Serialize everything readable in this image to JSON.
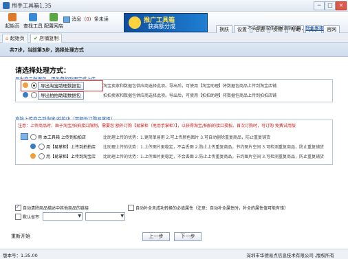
{
  "window": {
    "title": "甩手工具箱1.35",
    "controls": [
      "─",
      "□",
      "×"
    ]
  },
  "toolbar": {
    "start_label": "起始页",
    "search_label": "查找工具",
    "config_label": "配置网店",
    "message_label": "消息",
    "message_count": "0",
    "message_unread": "条未读",
    "banner_line1": "推广工具箱",
    "banner_line2": "获高额分成",
    "buttons": [
      "换肤",
      "设置",
      "日志",
      "反馈",
      "帮助",
      "关于",
      "官网"
    ],
    "notice_text": "不会使用或使用时遇到问题，",
    "notice_link": "联系客服"
  },
  "tabs": [
    "起始页",
    "店铺复制"
  ],
  "step": {
    "text": "共7步，当前第3步，选择处理方式"
  },
  "main": {
    "heading": "请选择处理方式：",
    "export_section_title": "导出商品数据包，用免费的助理完成上传",
    "export_options": [
      {
        "label": "导出淘宝助理数据包",
        "desc": "淘宝卖家和数据包供应商选择此项。导出后，可使用【淘宝助理】将数据包商品上传到淘宝店铺"
      },
      {
        "label": "导出拍拍助理数据包",
        "desc": "拍拍卖家和数据包供应商选择此项。导出后，可使用【拍拍助理】将数据包商品上传到拍拍店铺"
      }
    ],
    "direct_section_title": "直接上传商品到淘宝/拍拍店（需额外订购易掌柜）",
    "warning": "注意：上传商品时，由于淘宝/拍拍接口限制，需要您  额外订购【易掌柜（甩用手掌柜）】，以获得淘宝/拍拍的接口授权。首次订购时，可订购  免费试用版",
    "direct_options": [
      {
        "label": "用 本工具箱 上传到拍拍店",
        "desc": "比助理上传的优势：1.更简单易用 2.可上传颜色图片 3.可自动删除重复商品，防止重复铺货"
      },
      {
        "label": "用【易掌柜】上传到拍拍店",
        "desc": "比助理上传的优势：1.上传图片更稳定，不会丢图 2.防止上传重复商品，节约图片空间 3.可检测重复商品，防止重复铺货"
      },
      {
        "label": "用【易掌柜】上传到淘宝店",
        "desc": "比助理上传的优势：1.上传图片更稳定，不会丢图 2.防止上传重复商品，节约图片空间 3.可检测重复商品，防止重复铺货"
      }
    ],
    "checkbox_links": "自动清除商品描述中其他商品的链接",
    "checkbox_auto": "自动补全未成功转换的必填属性（注意：自动补全属性时，补全的属性值可能有错）",
    "checkbox_region": "默认省市",
    "restart_label": "重新开始",
    "prev_label": "上一步",
    "next_label": "下一步"
  },
  "status": {
    "version": "版本号：1.35.00",
    "company": "深圳市华德易点信息技术有限公司 ,版权所有"
  },
  "colors": {
    "accent": "#1d58a8",
    "warning": "#c61b1b",
    "highlight_box": "#d62a2a",
    "orange_option": "#f2a03c",
    "blue_option": "#3f7cc7"
  }
}
